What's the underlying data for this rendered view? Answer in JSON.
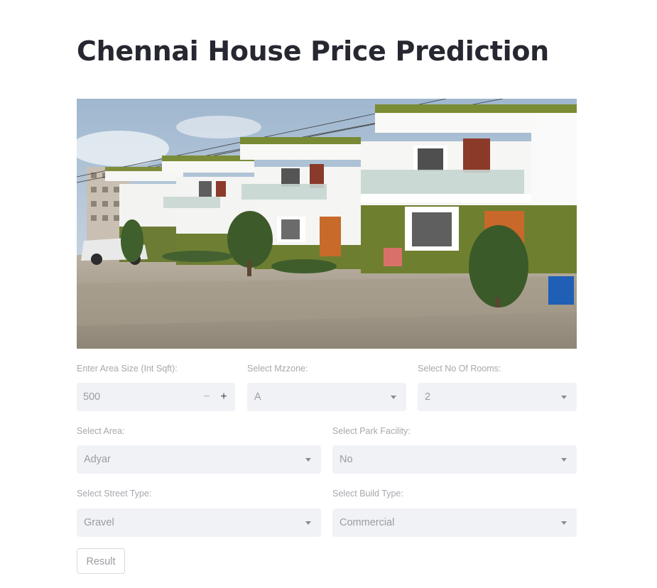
{
  "page": {
    "title": "Chennai House Price Prediction"
  },
  "colors": {
    "input_bg": "#f0f2f6",
    "label": "#a7a8ae",
    "value": "#9b9ca3",
    "title": "#262730"
  },
  "form": {
    "area_size": {
      "label": "Enter Area Size (Int Sqft):",
      "value": "500",
      "minus": "−",
      "plus": "+"
    },
    "mzzone": {
      "label": "Select Mzzone:",
      "value": "A"
    },
    "rooms": {
      "label": "Select No Of Rooms:",
      "value": "2"
    },
    "area": {
      "label": "Select Area:",
      "value": "Adyar"
    },
    "park": {
      "label": "Select Park Facility:",
      "value": "No"
    },
    "street": {
      "label": "Select Street Type:",
      "value": "Gravel"
    },
    "build": {
      "label": "Select Build Type:",
      "value": "Commercial"
    },
    "result_button": "Result"
  },
  "icons": {
    "dropdown": "chevron-down-icon",
    "stepper_minus": "minus-icon",
    "stepper_plus": "plus-icon"
  }
}
